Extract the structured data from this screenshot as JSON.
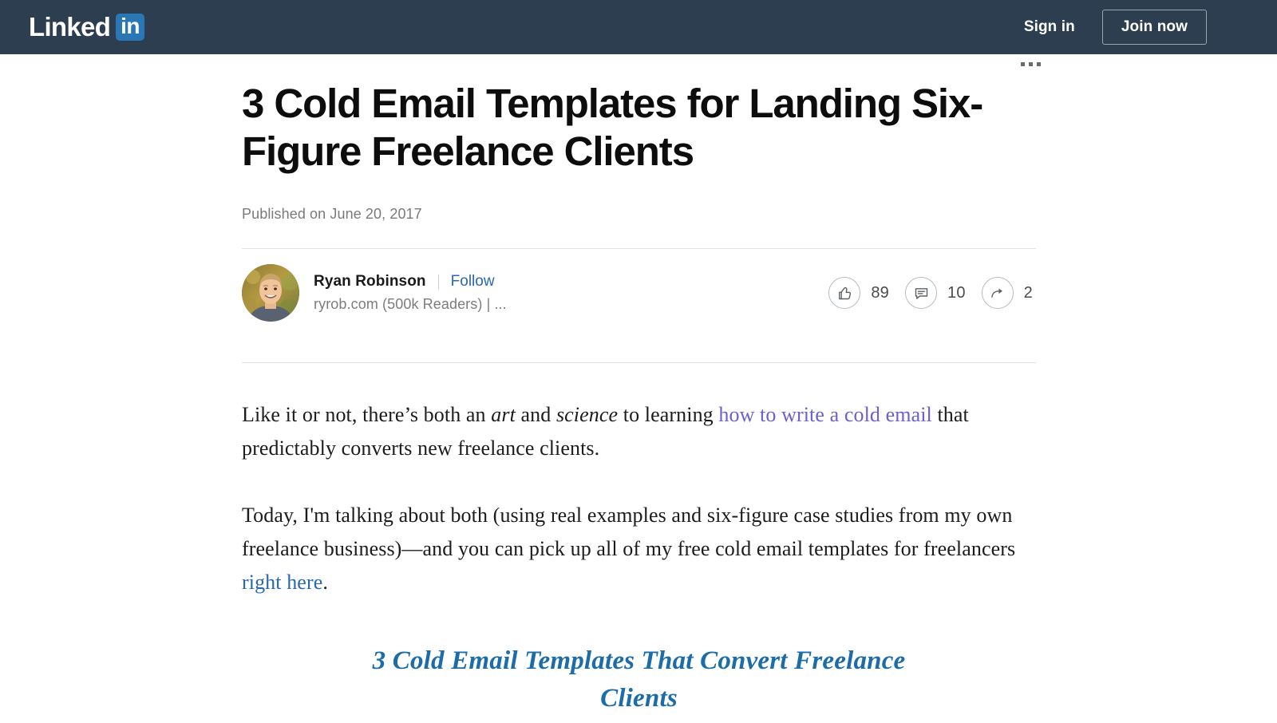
{
  "nav": {
    "logo_word": "Linked",
    "logo_badge": "in",
    "signin_label": "Sign in",
    "join_label": "Join now",
    "background_color": "#2d3e50",
    "badge_color": "#2977b5"
  },
  "article": {
    "title": "3 Cold Email Templates for Landing Six-Figure Freelance Clients",
    "published": "Published on June 20, 2017",
    "more_menu_label": "...",
    "author": {
      "name": "Ryan Robinson",
      "follow_label": "Follow",
      "subtitle": "ryrob.com (500k Readers) | ...",
      "avatar_alt": "Ryan Robinson profile photo"
    },
    "engagement": {
      "like_count": "89",
      "comment_count": "10",
      "share_count": "2"
    },
    "paragraphs": {
      "p1_part1": "Like it or not, there’s both an ",
      "p1_em1": "art",
      "p1_part2": " and ",
      "p1_em2": "science",
      "p1_part3": " to learning ",
      "p1_link": "how to write a cold email",
      "p1_part4": " that predictably converts new freelance clients.",
      "p2_part1": "Today, I'm talking about both (using real examples and six-figure case studies from my own freelance business)—and you can pick up all of my free cold email templates for freelancers ",
      "p2_link": "right here",
      "p2_part2": "."
    },
    "subheading": "3 Cold Email Templates That Convert Freelance Clients",
    "colors": {
      "link_visited": "#6a60d4",
      "link_blue": "#2867b2",
      "subheading_blue": "#1b6ca8"
    }
  },
  "icons": {
    "like": "thumbs-up-icon",
    "comment": "comment-bubble-icon",
    "share": "share-arrow-icon"
  }
}
